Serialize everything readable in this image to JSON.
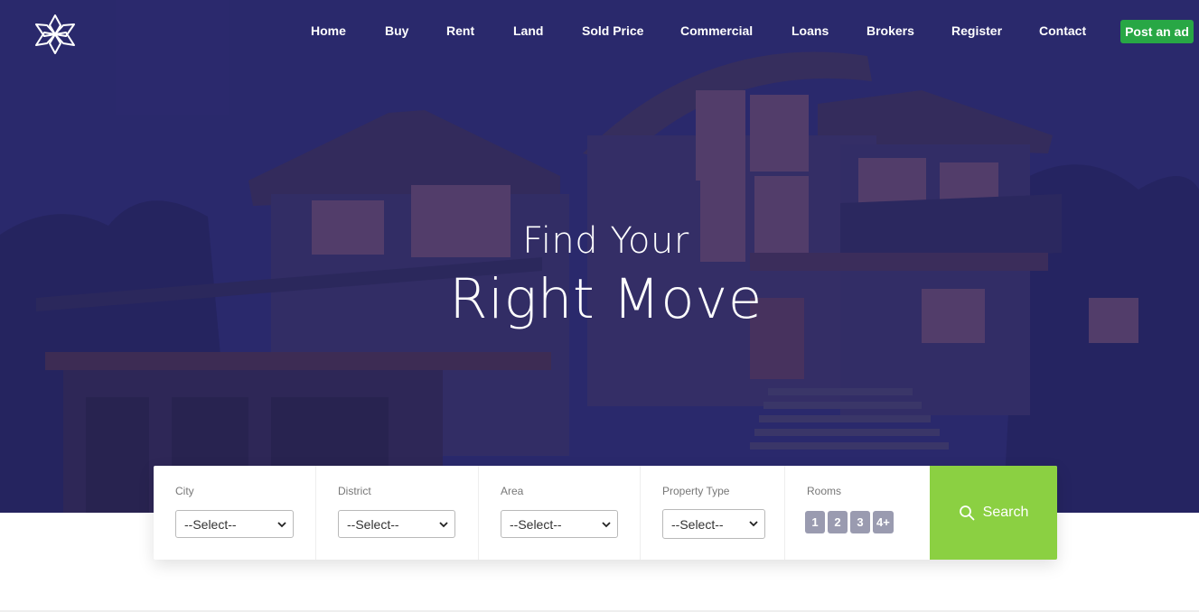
{
  "nav": {
    "items": [
      "Home",
      "Buy",
      "Rent",
      "Land",
      "Sold Price",
      "Commercial",
      "Loans",
      "Brokers",
      "Register",
      "Contact"
    ],
    "post_ad_label": "Post an ad"
  },
  "hero": {
    "line1": "Find Your",
    "line2": "Right Move"
  },
  "search": {
    "fields": [
      {
        "label": "City",
        "value": "--Select--"
      },
      {
        "label": "District",
        "value": "--Select--"
      },
      {
        "label": "Area",
        "value": "--Select--"
      },
      {
        "label": "Property Type",
        "value": "--Select--"
      }
    ],
    "rooms_label": "Rooms",
    "rooms": [
      "1",
      "2",
      "3",
      "4+"
    ],
    "button_label": "Search"
  },
  "icons": {
    "logo": "flower-logo-icon",
    "search": "search-icon",
    "select_arrow": "chevron-down-icon"
  },
  "colors": {
    "hero_overlay": "#2e2c6e",
    "post_button": "#28a745",
    "search_button": "#8bd042",
    "room_chip": "#9a9bb0"
  }
}
